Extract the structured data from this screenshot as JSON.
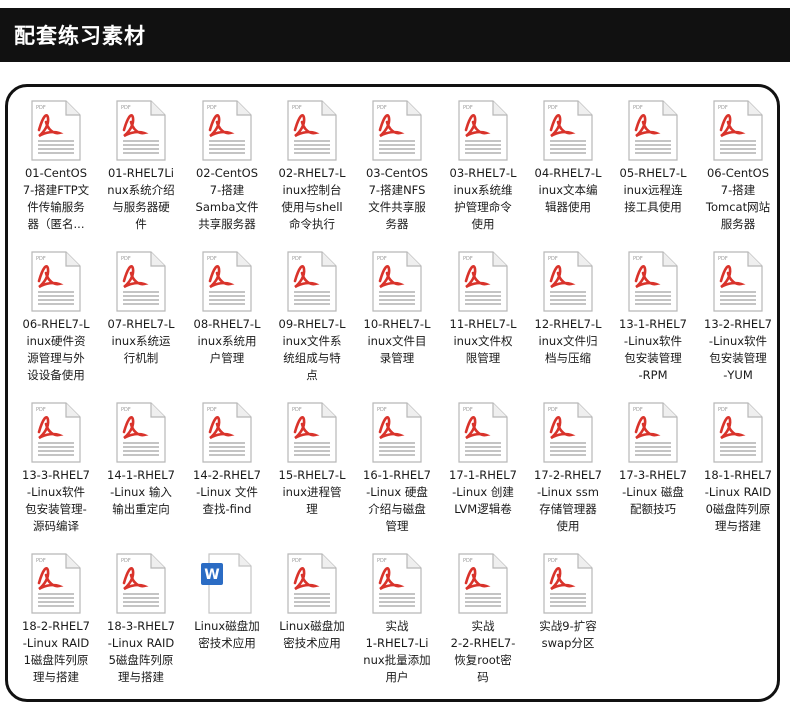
{
  "header": {
    "title": "配套练习素材"
  },
  "icons": {
    "pdf_tag": "PDF",
    "word_letter": "W"
  },
  "colors": {
    "pdf_red": "#d9332b",
    "word_blue": "#2b6cc4",
    "header_bg": "#111111"
  },
  "files": [
    {
      "name": "01-CentOS\n7-搭建FTP文\n件传输服务\n器（匿名...",
      "type": "pdf"
    },
    {
      "name": "01-RHEL7Li\nnux系统介绍\n与服务器硬\n件",
      "type": "pdf"
    },
    {
      "name": "02-CentOS\n7-搭建\nSamba文件\n共享服务器",
      "type": "pdf"
    },
    {
      "name": "02-RHEL7-L\ninux控制台\n使用与shell\n命令执行",
      "type": "pdf"
    },
    {
      "name": "03-CentOS\n7-搭建NFS\n文件共享服\n务器",
      "type": "pdf"
    },
    {
      "name": "03-RHEL7-L\ninux系统维\n护管理命令\n使用",
      "type": "pdf"
    },
    {
      "name": "04-RHEL7-L\ninux文本编\n辑器使用",
      "type": "pdf"
    },
    {
      "name": "05-RHEL7-L\ninux远程连\n接工具使用",
      "type": "pdf"
    },
    {
      "name": "06-CentOS\n7-搭建\nTomcat网站\n服务器",
      "type": "pdf"
    },
    {
      "name": "06-RHEL7-L\ninux硬件资\n源管理与外\n设设备使用",
      "type": "pdf"
    },
    {
      "name": "07-RHEL7-L\ninux系统运\n行机制",
      "type": "pdf"
    },
    {
      "name": "08-RHEL7-L\ninux系统用\n户管理",
      "type": "pdf"
    },
    {
      "name": "09-RHEL7-L\ninux文件系\n统组成与特\n点",
      "type": "pdf"
    },
    {
      "name": "10-RHEL7-L\ninux文件目\n录管理",
      "type": "pdf"
    },
    {
      "name": "11-RHEL7-L\ninux文件权\n限管理",
      "type": "pdf"
    },
    {
      "name": "12-RHEL7-L\ninux文件归\n档与压缩",
      "type": "pdf"
    },
    {
      "name": "13-1-RHEL7\n-Linux软件\n包安装管理\n-RPM",
      "type": "pdf"
    },
    {
      "name": "13-2-RHEL7\n-Linux软件\n包安装管理\n-YUM",
      "type": "pdf"
    },
    {
      "name": "13-3-RHEL7\n-Linux软件\n包安装管理-\n源码编译",
      "type": "pdf"
    },
    {
      "name": "14-1-RHEL7\n-Linux 输入\n输出重定向",
      "type": "pdf"
    },
    {
      "name": "14-2-RHEL7\n-Linux 文件\n查找-find",
      "type": "pdf"
    },
    {
      "name": "15-RHEL7-L\ninux进程管\n理",
      "type": "pdf"
    },
    {
      "name": "16-1-RHEL7\n-Linux 硬盘\n介绍与磁盘\n管理",
      "type": "pdf"
    },
    {
      "name": "17-1-RHEL7\n-Linux 创建\nLVM逻辑卷",
      "type": "pdf"
    },
    {
      "name": "17-2-RHEL7\n-Linux ssm\n存储管理器\n使用",
      "type": "pdf"
    },
    {
      "name": "17-3-RHEL7\n-Linux 磁盘\n配额技巧",
      "type": "pdf"
    },
    {
      "name": "18-1-RHEL7\n-Linux RAID\n0磁盘阵列原\n理与搭建",
      "type": "pdf"
    },
    {
      "name": "18-2-RHEL7\n-Linux RAID\n1磁盘阵列原\n理与搭建",
      "type": "pdf"
    },
    {
      "name": "18-3-RHEL7\n-Linux RAID\n5磁盘阵列原\n理与搭建",
      "type": "pdf"
    },
    {
      "name": "Linux磁盘加\n密技术应用",
      "type": "word"
    },
    {
      "name": "Linux磁盘加\n密技术应用",
      "type": "pdf"
    },
    {
      "name": "实战\n1-RHEL7-Li\nnux批量添加\n用户",
      "type": "pdf"
    },
    {
      "name": "实战\n2-2-RHEL7-\n恢复root密\n码",
      "type": "pdf"
    },
    {
      "name": "实战9-扩容\nswap分区",
      "type": "pdf"
    }
  ]
}
